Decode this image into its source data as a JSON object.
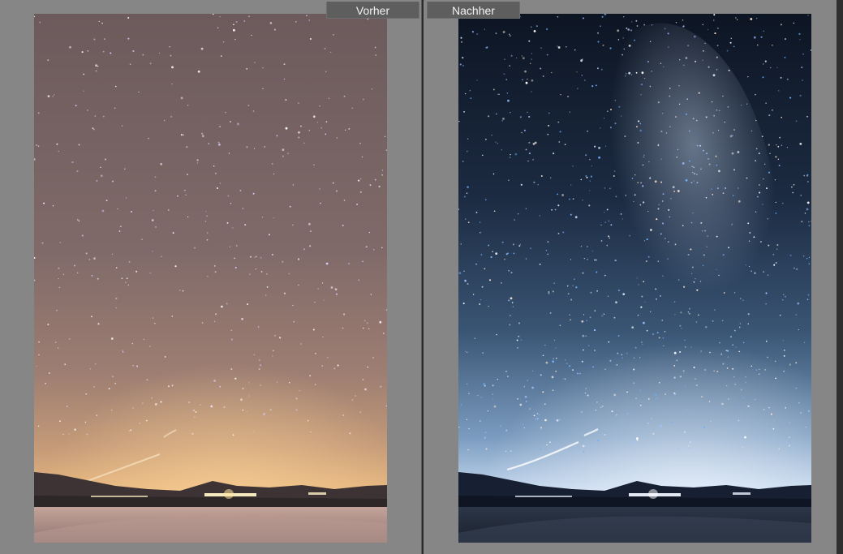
{
  "compare_view": {
    "before_label": "Vorher",
    "after_label": "Nachher"
  },
  "photos": {
    "before": {
      "subject": "starry-night-sky-image",
      "tone": "warm"
    },
    "after": {
      "subject": "starry-night-sky-image",
      "tone": "cool"
    }
  }
}
